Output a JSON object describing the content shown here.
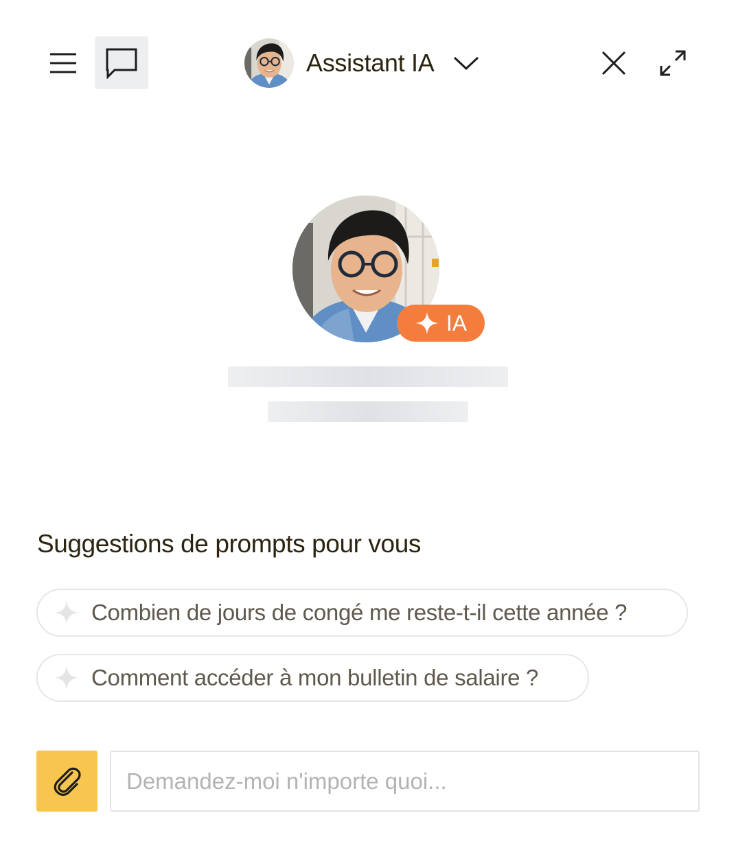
{
  "header": {
    "agent_name": "Assistant IA",
    "icons": {
      "menu": "hamburger-menu-icon",
      "chat": "chat-bubble-icon",
      "dropdown": "chevron-down-icon",
      "close": "close-icon",
      "expand": "expand-icon"
    }
  },
  "hero": {
    "badge_label": "IA",
    "badge_color": "#f47c3c"
  },
  "suggestions": {
    "title": "Suggestions de prompts pour vous",
    "items": [
      "Combien de jours de congé me reste-t-il cette année ?",
      "Comment accéder à mon bulletin de salaire ?"
    ]
  },
  "composer": {
    "placeholder": "Demandez-moi n'importe quoi...",
    "value": "",
    "attach_color": "#f8c64f"
  }
}
